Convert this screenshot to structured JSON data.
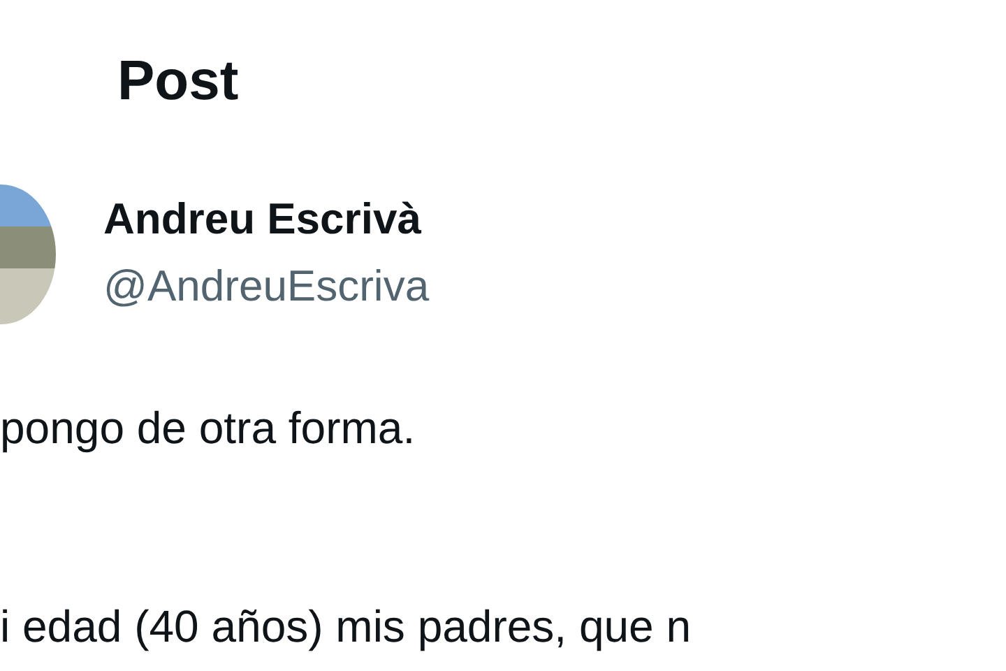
{
  "header": {
    "title": "Post"
  },
  "author": {
    "name": "Andreu Escrivà",
    "handle": "@AndreuEscriva"
  },
  "body": [
    "pongo de otra forma.",
    "i edad (40 años) mis padres, que n"
  ]
}
